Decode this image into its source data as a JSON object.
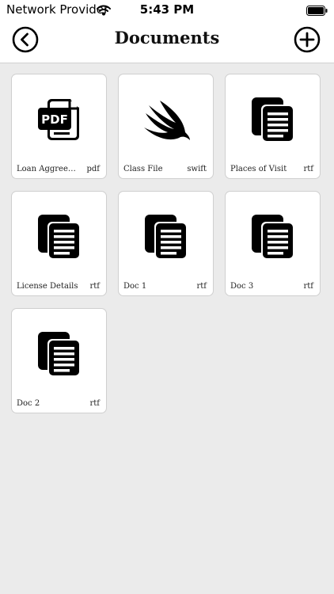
{
  "status_bar": {
    "carrier": "Network Provider",
    "time": "5:43 PM"
  },
  "nav": {
    "title": "Documents",
    "back_icon": "chevron-left-circle-icon",
    "add_icon": "plus-circle-icon"
  },
  "documents": [
    {
      "name": "Loan Aggreement",
      "ext": "pdf",
      "icon": "pdf-icon"
    },
    {
      "name": "Class File",
      "ext": "swift",
      "icon": "swift-icon"
    },
    {
      "name": "Places of Visit",
      "ext": "rtf",
      "icon": "copy-document-icon"
    },
    {
      "name": "License Details",
      "ext": "rtf",
      "icon": "copy-document-icon"
    },
    {
      "name": "Doc 1",
      "ext": "rtf",
      "icon": "copy-document-icon"
    },
    {
      "name": "Doc 3",
      "ext": "rtf",
      "icon": "copy-document-icon"
    },
    {
      "name": "Doc 2",
      "ext": "rtf",
      "icon": "copy-document-icon"
    }
  ],
  "colors": {
    "background": "#ebebeb",
    "card": "#ffffff",
    "icon": "#000000"
  }
}
